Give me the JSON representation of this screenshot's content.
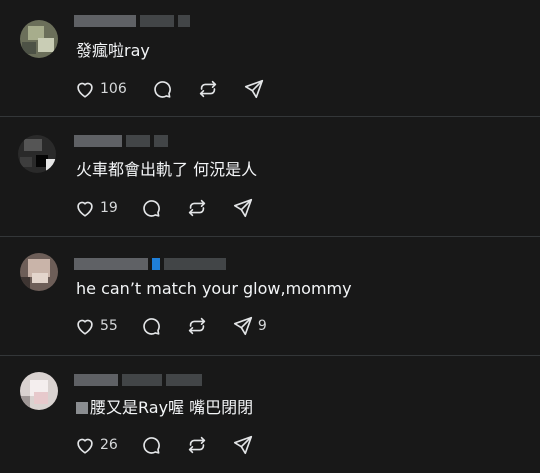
{
  "comments": [
    {
      "text": "發瘋啦ray",
      "likes": "106",
      "shares": ""
    },
    {
      "text": "火車都會出軌了 何況是人",
      "likes": "19",
      "shares": ""
    },
    {
      "text": "he can’t match your glow,mommy",
      "likes": "55",
      "shares": "9"
    },
    {
      "text": "腰又是Ray喔 嘴巴閉閉",
      "likes": "26",
      "shares": ""
    }
  ],
  "icons": {
    "like": "heart-icon",
    "reply": "speech-bubble-icon",
    "repost": "repost-icon",
    "share": "send-icon"
  },
  "colors": {
    "background": "#181818",
    "divider": "#333638",
    "text": "#f3f5f7",
    "verified_accent": "#1f7fd8"
  }
}
